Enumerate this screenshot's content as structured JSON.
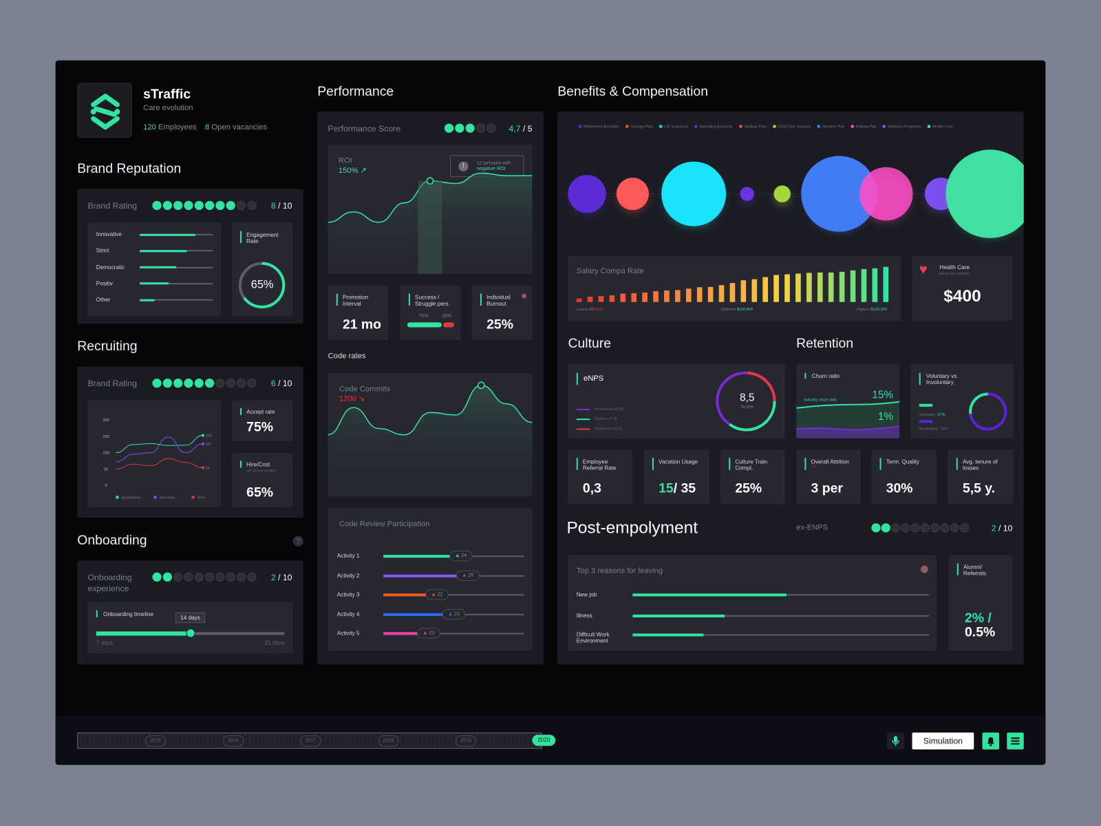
{
  "company": {
    "name": "sTraffic",
    "tagline": "Care evolution",
    "employees_count": "120",
    "employees_label": "Employees",
    "vacancies_count": "8",
    "vacancies_label": "Open vacancies"
  },
  "brand_reputation": {
    "title": "Brand Reputation",
    "rating_label": "Brand Rating",
    "rating": 8,
    "max": 10,
    "rating_value": "8",
    "rating_max": "/ 10",
    "traits": [
      {
        "label": "Innovative",
        "value": 0.76
      },
      {
        "label": "Strict",
        "value": 0.64
      },
      {
        "label": "Democratic",
        "value": 0.5
      },
      {
        "label": "Positiv",
        "value": 0.39
      },
      {
        "label": "Other",
        "value": 0.2
      }
    ],
    "engagement_label": "Engagement Rate",
    "engagement_value": "65%",
    "engagement_fraction": 0.65
  },
  "recruiting": {
    "title": "Recruiting",
    "rating_label": "Brand Rating",
    "rating": 6,
    "max": 10,
    "rating_value": "6",
    "rating_max": "/ 10",
    "accept_label": "Accept rate",
    "accept_value": "75%",
    "hire_label": "Hire/Cost",
    "hire_sub": "per person monthly",
    "hire_value": "65%"
  },
  "chart_data": {
    "type": "line",
    "yticks": [
      "200",
      "150",
      "100",
      "50",
      "0"
    ],
    "ylim": [
      0,
      200
    ],
    "series": [
      {
        "name": "Applications",
        "color": "#33e3a0",
        "values": [
          100,
          125,
          128,
          122,
          123,
          153
        ],
        "end_label": "153"
      },
      {
        "name": "Interviews",
        "color": "#7a54f5",
        "values": [
          72,
          95,
          100,
          148,
          100,
          127
        ],
        "end_label": "127"
      },
      {
        "name": "Hires",
        "color": "#e2383f",
        "values": [
          50,
          65,
          60,
          82,
          70,
          54
        ],
        "end_label": "54"
      }
    ]
  },
  "onboarding": {
    "title": "Onboarding",
    "help": "?",
    "exp_label": "Onboarding experience",
    "rating": 2,
    "max": 10,
    "rating_value": "2",
    "rating_max": "/ 10",
    "timeline_label": "Onboarding timeline",
    "tooltip": "14 days",
    "min_label": "7 days",
    "max_label": "21 days",
    "value_fraction": 0.5
  },
  "performance": {
    "title": "Performance",
    "score_label": "Performance Score",
    "score_dots": 3,
    "score_max": 5,
    "score_value": "4,7",
    "score_max_label": "/ 5",
    "roi_label": "ROI",
    "roi_value": "150%",
    "alert_line1": "12 persons with",
    "alert_line2": "negative ROI",
    "roi_series": [
      40,
      48,
      40,
      55,
      72,
      70,
      78,
      76,
      76
    ],
    "promotion_label": "Promotion Interval",
    "promotion_value": "21 mo",
    "success_label": "Success / Struggle pers.",
    "success_pct": "75%",
    "struggle_pct": "25%",
    "success_fraction": 0.75,
    "burnout_label": "Individual Burnout",
    "burnout_value": "25%",
    "code_rates_label": "Code rates",
    "commits_label": "Code Commits",
    "commits_value": "1200",
    "commits_series": [
      50,
      72,
      55,
      50,
      68,
      66,
      90,
      75,
      60
    ],
    "review_label": "Code Review Participation",
    "activities": [
      {
        "label": "Activity 1",
        "count": "24",
        "fraction": 0.48,
        "color": "#33e3a0"
      },
      {
        "label": "Activity 2",
        "count": "26",
        "fraction": 0.53,
        "color": "#8a55f5"
      },
      {
        "label": "Activity 3",
        "count": "22",
        "fraction": 0.31,
        "color": "#fb5a1e"
      },
      {
        "label": "Activity 4",
        "count": "23",
        "fraction": 0.43,
        "color": "#2a6cf5"
      },
      {
        "label": "Activity 5",
        "count": "23",
        "fraction": 0.25,
        "color": "#f53fa5"
      }
    ]
  },
  "benefits": {
    "title": "Benefits & Compensation",
    "legend": [
      {
        "label": "Retirement Annuities",
        "color": "#6a28d8"
      },
      {
        "label": "Savings Plan",
        "color": "#ff4d4d"
      },
      {
        "label": "Life Insurance",
        "color": "#1ad8f5"
      },
      {
        "label": "Spending Accounts",
        "color": "#6a28d8"
      },
      {
        "label": "Savings Plan",
        "color": "#ff4d4d"
      },
      {
        "label": "Child Care Subsidy",
        "color": "#a5d63c"
      },
      {
        "label": "Vacation Pay",
        "color": "#3f7cf5"
      },
      {
        "label": "Holiday Pay",
        "color": "#ff4fc7"
      },
      {
        "label": "Wellness Programs",
        "color": "#8a55f5"
      },
      {
        "label": "Health Care",
        "color": "#3fe0a2"
      }
    ],
    "bubbles": [
      {
        "color": "#5b2bd6",
        "size": 27
      },
      {
        "color": "#ff5a5a",
        "size": 23
      },
      {
        "color": "#1ae3fb",
        "size": 46
      },
      {
        "color": "#6a34e0",
        "size": 10
      },
      {
        "color": "#a5d63c",
        "size": 12
      },
      {
        "color": "#3f7cf5",
        "size": 54
      },
      {
        "color": "#ff4fc7",
        "size": 38
      },
      {
        "color": "#7a4ff0",
        "size": 23
      },
      {
        "color": "#3fe0a2",
        "size": 63
      }
    ],
    "salary_label": "Salary Compa Rate",
    "lowest_label": "Lowest",
    "lowest_value": "$80,600",
    "mid_label": "Midpoint",
    "mid_value": "$100,400",
    "high_label": "Highest",
    "high_value": "$120,300",
    "salary_bars": [
      10,
      15,
      17,
      19,
      24,
      25,
      27,
      31,
      33,
      34,
      38,
      42,
      43,
      48,
      54,
      62,
      65,
      71,
      77,
      79,
      81,
      83,
      84,
      84,
      86,
      90,
      94,
      96,
      100
    ],
    "health_label": "Health Care",
    "health_sub": "per person monthly",
    "health_value": "$400"
  },
  "culture": {
    "title": "Culture",
    "enps_label": "eNPS",
    "enps_value": "8,5",
    "enps_sub": "Score",
    "legend": [
      {
        "label": "Promotors (9-10)",
        "color": "#7a2ad0"
      },
      {
        "label": "Pasives (7-8)",
        "color": "#33e3a0"
      },
      {
        "label": "Detractors (0-6)",
        "color": "#e5384a"
      }
    ]
  },
  "retention": {
    "title": "Retention",
    "churn_label": "Churn ratio",
    "industry_label": "Industry churn ratio",
    "churn_high": "15%",
    "churn_low": "1%",
    "vol_label": "Voluntary vs Involuntary",
    "voluntary_label": "Voluntary",
    "voluntary_value": "27%",
    "involuntary_label": "Involuntary",
    "involuntary_value": "73%",
    "voluntary_fraction": 0.27
  },
  "kpis": [
    {
      "label": "Employee Referral Rate",
      "value": "0,3"
    },
    {
      "label": "Vacation Usage",
      "value_green": "15",
      "value": "/ 35"
    },
    {
      "label": "Culture Train Compl.",
      "value": "25%"
    },
    {
      "label": "Overall Attrition",
      "sub": "/ %",
      "value": "3 per"
    },
    {
      "label": "Term. Quality",
      "value": "30%"
    },
    {
      "label": "Avg. tenure of losses",
      "value": "5,5 y."
    }
  ],
  "post": {
    "title": "Post-empolyment",
    "exenps_label": "ex-ENPS",
    "rating": 2,
    "max": 10,
    "rating_value": "2",
    "rating_max": "/ 10",
    "reasons_label": "Top 3 reasons for leaving",
    "reasons": [
      {
        "label": "New job",
        "fraction": 0.52
      },
      {
        "label": "Illness",
        "fraction": 0.31
      },
      {
        "label": "Difficult Work Environment",
        "fraction": 0.24
      }
    ],
    "alumni_label": "Alumni/ Referrals",
    "alumni_green": "2% /",
    "alumni_value": "0.5%"
  },
  "timeline": {
    "years": [
      "2015",
      "2016",
      "2017",
      "2018",
      "2019"
    ],
    "current": "2020"
  },
  "toolbar": {
    "simulation_label": "Simulation"
  }
}
